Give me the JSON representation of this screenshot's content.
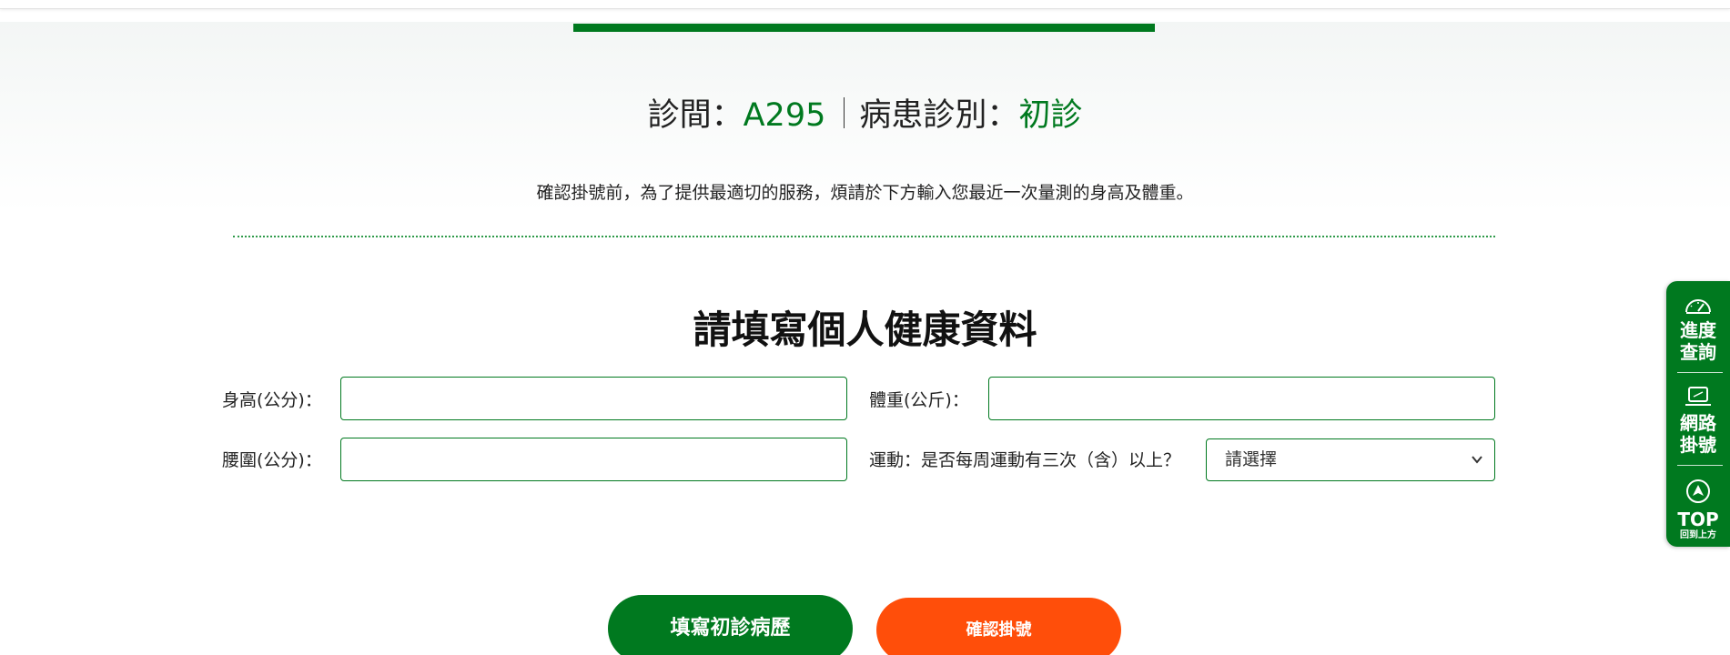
{
  "header": {
    "clinic_label": "診間：",
    "clinic_value": "A295",
    "patient_type_label": "病患診別：",
    "patient_type_value": "初診"
  },
  "notice": "確認掛號前，為了提供最適切的服務，煩請於下方輸入您最近一次量測的身高及體重。",
  "form": {
    "title": "請填寫個人健康資料",
    "height_label": "身高(公分)：",
    "height_value": "",
    "weight_label": "體重(公斤)：",
    "weight_value": "",
    "waist_label": "腰圍(公分)：",
    "waist_value": "",
    "exercise_label": "運動：是否每周運動有三次（含）以上？",
    "exercise_selected": "請選擇"
  },
  "buttons": {
    "history_label": "填寫初診病歷",
    "confirm_label": "確認掛號"
  },
  "side_panel": {
    "progress_line1": "進度",
    "progress_line2": "查詢",
    "online_line1": "網路",
    "online_line2": "掛號",
    "top_label": "TOP",
    "top_sub": "回到上方"
  },
  "colors": {
    "brand_green": "#00791f",
    "confirm_orange": "#ff4e0a"
  },
  "icons": [
    "gauge-icon",
    "laptop-icon",
    "arrow-up-circle-icon",
    "chevron-down-icon"
  ]
}
